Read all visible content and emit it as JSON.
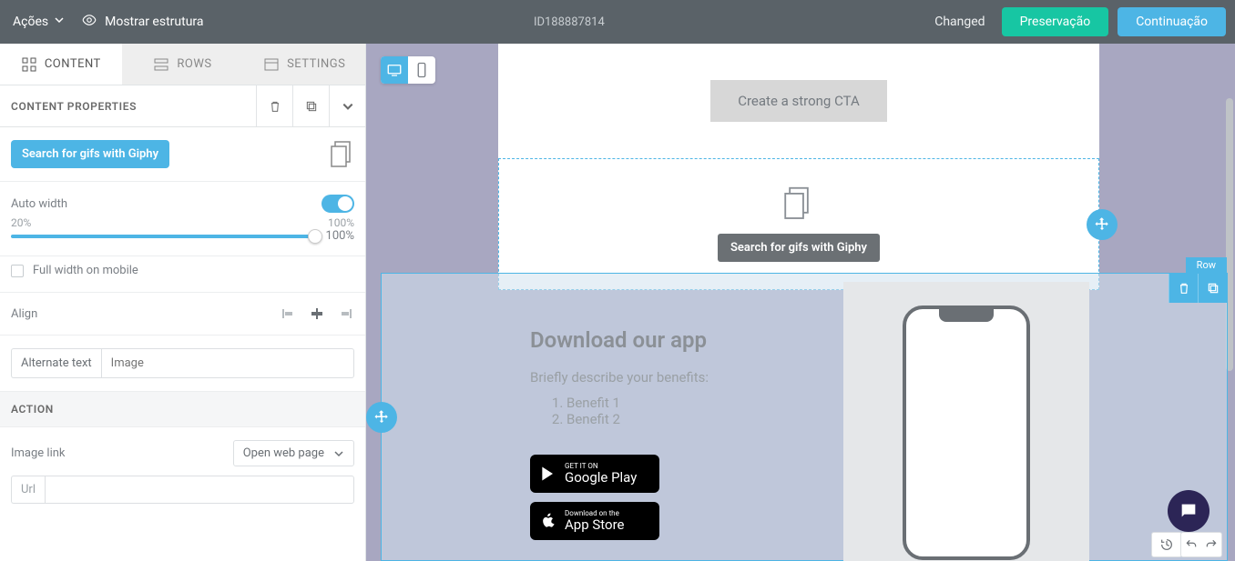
{
  "topbar": {
    "actions": "Ações",
    "show_structure": "Mostrar estrutura",
    "id": "ID188887814",
    "status": "Changed",
    "preserve": "Preservação",
    "continue": "Continuação"
  },
  "tabs": {
    "content": "CONTENT",
    "rows": "ROWS",
    "settings": "SETTINGS"
  },
  "panel": {
    "title": "CONTENT PROPERTIES"
  },
  "giphy": {
    "button": "Search for gifs with Giphy"
  },
  "autowidth": {
    "label": "Auto width",
    "min": "20%",
    "max": "100%",
    "value": "100%",
    "full_mobile": "Full width on mobile"
  },
  "align": {
    "label": "Align"
  },
  "alt": {
    "label": "Alternate text",
    "placeholder": "Image"
  },
  "action": {
    "header": "ACTION",
    "image_link": "Image link",
    "select": "Open web page",
    "url_prefix": "Url"
  },
  "canvas": {
    "cta": "Create a strong CTA",
    "sel_btn": "Search for gifs with Giphy",
    "row_tag": "Row",
    "app_title": "Download our app",
    "app_desc": "Briefly describe your benefits:",
    "benefit1": "Benefit 1",
    "benefit2": "Benefit 2",
    "gp_small": "GET IT ON",
    "gp_big": "Google Play",
    "as_small": "Download on the",
    "as_big": "App Store"
  }
}
